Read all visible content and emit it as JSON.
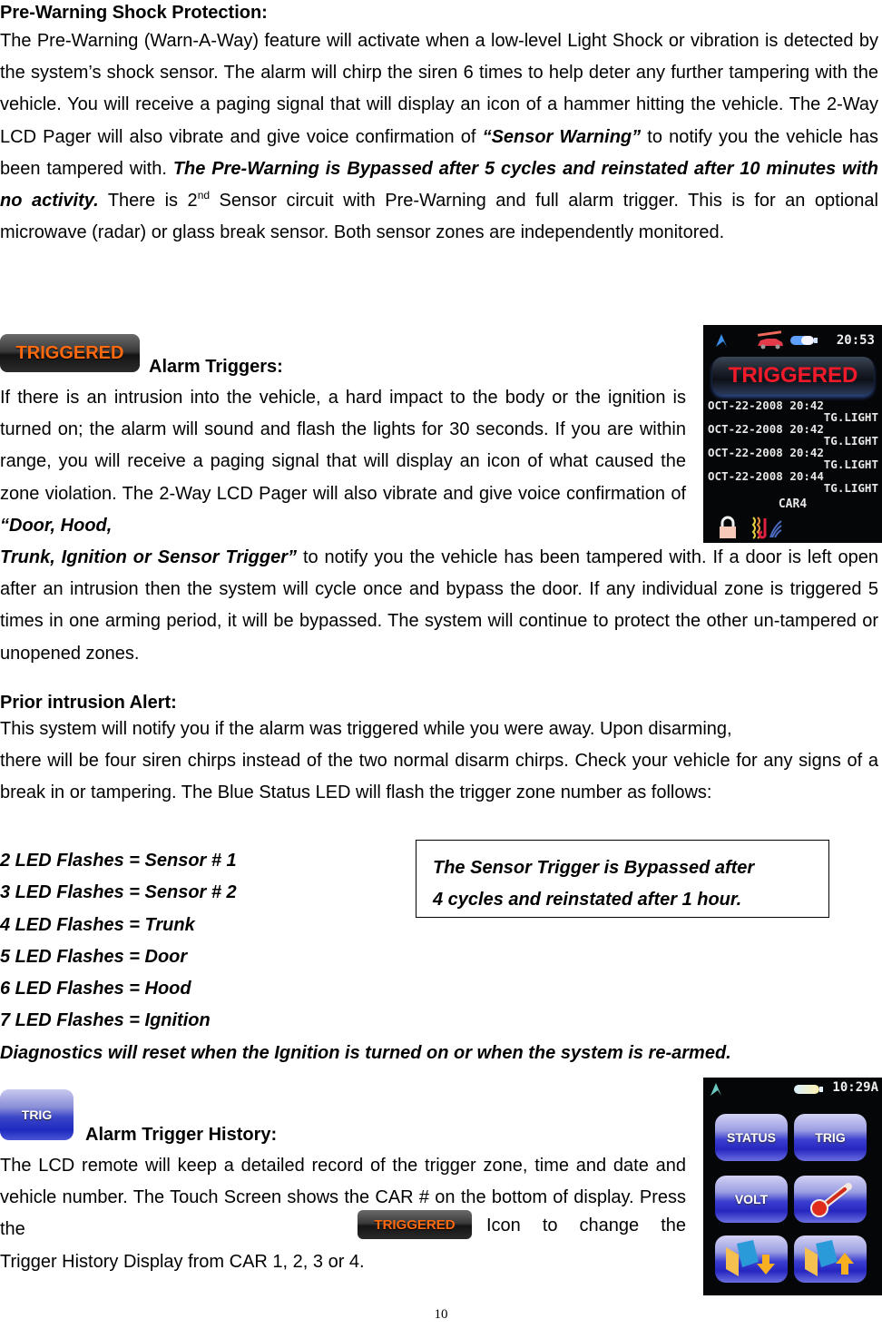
{
  "section1": {
    "heading": "Pre-Warning Shock Protection:",
    "para_before_quote": "The Pre-Warning (Warn-A-Way) feature will activate when a low-level Light Shock or vibration is detected by the system’s shock sensor. The alarm will chirp the siren 6 times to help deter any further tampering with the vehicle. You will receive a paging signal that will display an icon of a hammer hitting the vehicle. The 2-Way LCD Pager will also vibrate and give voice confirmation of ",
    "quote": "“Sensor Warning”",
    "para_after_quote": " to notify you the vehicle has been tampered with. ",
    "bold_note": "The Pre-Warning is Bypassed after 5 cycles and reinstated after 10 minutes with no activity.",
    "para_tail_1": " There is 2",
    "superscript": "nd",
    "para_tail_2": " Sensor circuit with Pre-Warning and full alarm trigger. This is for an optional microwave (radar) or glass break sensor. Both sensor zones are independently monitored."
  },
  "section2": {
    "icon_label": "TRIGGERED",
    "heading": "Alarm Triggers:",
    "para_before_quote": "If there is an intrusion into the vehicle, a hard impact to the body or the ignition is turned on; the alarm will sound and flash the lights for 30 seconds. If you are within range, you will receive a paging signal that will display an icon of what caused the zone violation. The 2-Way LCD Pager will also vibrate and give voice confirmation of ",
    "quote_part1": "“Door, Hood,",
    "quote_part2": "Trunk, Ignition or Sensor Trigger”",
    "para_after_quote": " to notify you the vehicle has been tampered with. If a door is left open after an intrusion then the system will cycle once and bypass the door. If any individual zone is triggered 5 times in one arming period, it will be bypassed. The system will continue to protect the other un-tampered or unopened zones.",
    "screen": {
      "clock": "20:53",
      "banner": "TRIGGERED",
      "entries": [
        {
          "date": "OCT-22-2008",
          "time": "20:42",
          "zone": "TG.LIGHT"
        },
        {
          "date": "OCT-22-2008",
          "time": "20:42",
          "zone": "TG.LIGHT"
        },
        {
          "date": "OCT-22-2008",
          "time": "20:42",
          "zone": "TG.LIGHT"
        },
        {
          "date": "OCT-22-2008",
          "time": "20:44",
          "zone": "TG.LIGHT"
        }
      ],
      "car": "CAR4"
    }
  },
  "section3": {
    "heading": "Prior intrusion Alert:",
    "line1": "This system will notify you if the alarm was triggered while you were away. Upon disarming,",
    "para": "there will be four siren chirps instead of the two normal disarm chirps. Check your vehicle for any signs of a break in or tampering. The Blue Status LED will flash the trigger zone number as follows:",
    "led_list": [
      "2 LED Flashes = Sensor # 1",
      "3 LED Flashes = Sensor # 2",
      "4 LED Flashes = Trunk",
      "5 LED Flashes = Door",
      "6 LED Flashes = Hood",
      "7 LED Flashes = Ignition"
    ],
    "diagnostics_note": "Diagnostics will reset when the Ignition is turned on or when the system is re-armed.",
    "box_line1": "The Sensor Trigger is Bypassed after",
    "box_line2": "4 cycles and reinstated after 1 hour."
  },
  "section4": {
    "icon_label": "TRIG",
    "heading": "Alarm Trigger History:",
    "para_part1": "The LCD remote will keep a detailed record of the trigger zone, time and date and vehicle number. The Touch Screen shows the CAR # on the bottom of display. Press the",
    "inline_icon_label": "TRIGGERED",
    "para_part2": "Icon to change the",
    "para_part3": "Trigger History Display from CAR 1, 2, 3 or 4.",
    "screen": {
      "clock": "10:29A",
      "buttons": [
        "STATUS",
        "TRIG",
        "VOLT",
        "",
        "",
        ""
      ],
      "button_icons": [
        "",
        "",
        "",
        "thermometer-icon",
        "folder-download-icon",
        "folder-upload-icon"
      ]
    }
  },
  "footer": {
    "page_number": "10"
  }
}
